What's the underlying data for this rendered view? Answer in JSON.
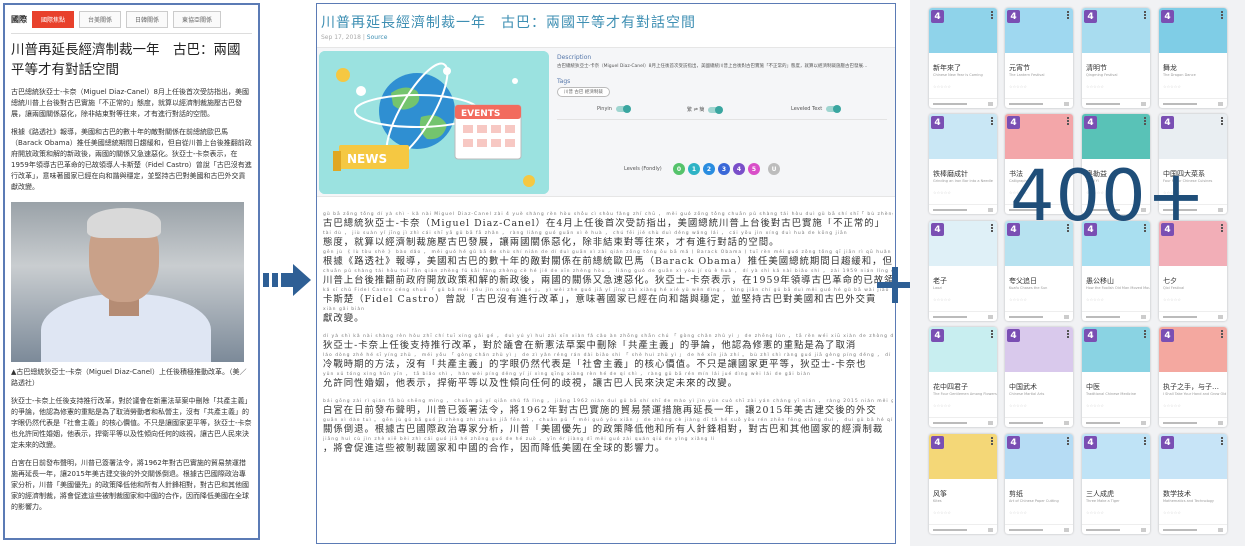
{
  "article": {
    "nav_home": "國際",
    "nav_tabs": [
      "國際焦點",
      "台美關係",
      "日韓關係",
      "東協亞關係"
    ],
    "title": "川普再延長經濟制裁一年　古巴：兩國平等才有對話空間",
    "para1": "古巴總統狄亞士-卡奈（Miguel Diaz-Canel）8月上任後首次受訪指出，美國總統川普上台後對古巴實施「不正常的」態度，就算以經濟制裁施壓古巴發展，讓兩國關係惡化，除非結束對等往來，才有進行對話的空間。",
    "para2": "根據《路透社》報導，美國和古巴的數十年的敵對關係在前總統歐巴馬（Barack Obama）推任美國總統期間日趨緩和，但自從川普上台後推翻前政府開放政策和解的新政後，兩國的關係又急速惡化。狄亞士-卡奈表示，在1959年領導古巴革命的已故領導人卡斯楚（Fidel Castro）曾說「古巴沒有進行改革」，意味著國家已經在向和諧與穩定，並堅持古巴對美國和古巴外交貢獻改變。",
    "caption": "▲古巴總統狄亞士-卡奈（Miguel Diaz-Canel）上任後積極推動改革。（美／路透社）",
    "para3": "狄亞士-卡奈上任後支持推行改革，對於議會在新憲法草案中刪除「共產主義」的爭論，他認為修憲的重點是為了取消勞動者和私營主，沒有「共產主義」的字眼仍然代表是「社會主義」的核心價值。不只是讓國家更平等，狄亞士-卡奈也允許同性婚姻，他表示，捍衛平等以及性傾向任何的歧視，讓古巴人民來決定未來的改變。",
    "para4": "白宮在日前發布聲明，川普已簽署法令，將1962年對古巴實施的貿易禁運措施再延長一年，讓2015年美古建交後的外交關係倒退。根據古巴國際政治專家分析，川普「美國優先」的政策降低他和所有人針鋒相對，對古巴和其他國家的經濟制裁，將會促進這些被制裁國家和中國的合作，因而降低美國在全球的影響力。"
  },
  "reader": {
    "title": "川普再延長經濟制裁一年　古巴：兩國平等才有對話空間",
    "date": "Sep 17, 2018 |",
    "source": "Source",
    "illus_events": "EVENTS",
    "illus_news": "NEWS",
    "description_label": "Description",
    "description_text": "古巴總統狄亞士-卡奈（Miguel Diaz-Canel）8月上任後首次受訪指出，美國總統川普上台後對古巴實施「不正常的」態度，就算以經濟制裁施壓古巴發展…",
    "tags_label": "Tags",
    "tag": "川普 古巴 經濟制裁",
    "toggles": [
      {
        "label": "Pinyin"
      },
      {
        "label": "繁 ⇌ 簡"
      },
      {
        "label": "Leveled Text"
      }
    ],
    "levels_label": "Levels (Fondly)",
    "levels": [
      {
        "label": "0",
        "color": "#55c36b"
      },
      {
        "label": "1",
        "color": "#2eb3c5"
      },
      {
        "label": "2",
        "color": "#2a8de0"
      },
      {
        "label": "3",
        "color": "#3a68d8"
      },
      {
        "label": "4",
        "color": "#7a4fc9"
      },
      {
        "label": "5",
        "color": "#d94fc8"
      },
      {
        "label": "U",
        "color": "#bdbdbd"
      }
    ],
    "lines": [
      {
        "py": "gǔ bā zǒng tǒng dí yà shì · kǎ nài     Miguel  Diaz-Canel    zài 4 yuè shàng rèn hòu shǒu cì shòu fǎng zhǐ chū ， měi guó zǒng tǒng chuān pǔ shàng tái hòu duì gǔ bā shí shī「 bù zhèng cháng de 」",
        "zh": "古巴總統狄亞士-卡奈（Miguel Diaz-Canel）在4月上任後首次受訪指出，美國總統川普上台後對古巴實施「不正常的」"
      },
      {
        "py": "tài dù ， jiù suàn yǐ jīng jì zhì cái shī yā gǔ bā fā zhǎn ， ràng liǎng guó guān xì è huà ， chú fēi jié shù duì děng wǎng lái ， cái yǒu jìn xíng duì huà de kōng jiān",
        "zh": "態度，就算以經濟制裁施壓古巴發展，讓兩國關係惡化，除非結束對等往來，才有進行對話的空間。"
      },
      {
        "py": "gēn jù 《 lù tòu shè 》 bào dǎo ， měi guó hé gǔ bā de shù shí nián de dí duì guān xì zài qián zǒng tǒng ōu bā mǎ  ( Barack Obama ) tuī rèn měi guó zǒng tǒng qī jiān rì qū huǎn hé",
        "zh": "根據《路透社》報導，美國和古巴的數十年的敵對關係在前總統歐巴馬（Barack Obama）推任美國總統期間日趨緩和，但自從"
      },
      {
        "py": "chuān pǔ shàng tái hòu tuī fān qián zhèng fǔ kāi fàng zhèng cè hé jiě de xīn zhèng hòu ， liǎng guó de guān xì yòu jí sù è huà ， dí yà shì kǎ nài biǎo shì ， zài 1959 nián lǐng dǎo gǔ bā gé mìng",
        "zh": "川普上台後推翻前政府開放政策和解的新政後，兩國的關係又急速惡化。狄亞士-卡奈表示，在1959年領導古巴革命的已故領導人"
      },
      {
        "py": "kǎ sī chǔ   Fidel Castro   céng shuō 「 gǔ bā méi yǒu jìn xíng gǎi gé 」， yì wèi zhe guó jiā yǐ jīng zài xiàng hé xié yǔ wěn dìng ， bìng jiān chí gǔ bā duì měi guó hé gǔ bā wài jiāo",
        "zh": "卡斯楚（Fidel Castro）曾說「古巴沒有進行改革」，意味著國家已經在向和諧與穩定，並堅持古巴對美國和古巴外交貢"
      },
      {
        "py": "xiàn gǎi biàn",
        "zh": "獻改變。"
      },
      {
        "py": "dí yà shì kǎ nài shàng rèn hòu zhī chí tuī xíng gǎi gé ， duì yú yì huì zài xīn xiàn fǎ cǎo àn zhōng shān chú 「 gòng chǎn zhǔ yì 」 de zhēng lùn ， tā rèn wéi xiū xiàn de zhòng diǎn shì wèi le qǔ xiāo",
        "zh": "狄亞士-卡奈上任後支持推行改革，對於議會在新憲法草案中刪除「共產主義」的爭論，他認為修憲的重點是為了取消"
      },
      {
        "py": "láo dòng zhě hé sī yíng zhǔ ， méi yǒu 「 gòng chǎn zhǔ yì 」 de zì yǎn réng rán dài biǎo shì 「 shè huì zhǔ yì 」 de hé xīn jià zhí 。 bù zhǐ shì ràng guó jiā gèng píng děng ， dí yà shì kǎ nài yě",
        "zh": "冷戰時期的方法，沒有「共產主義」的字眼仍然代表是「社會主義」的核心價值。不只是讓國家更平等，狄亞士-卡奈也"
      },
      {
        "py": "yǔn xǔ tóng xìng hūn yīn ， tā biǎo shì ， hàn wèi píng děng yǐ jí xìng qīng xiàng rèn hé de qí shì ， ràng gǔ bā rén mín lái jué dìng wèi lái de gǎi biàn",
        "zh": "允許同性婚姻，他表示，捍衛平等以及性傾向任何的歧視，讓古巴人民來決定未來的改變。"
      },
      {
        "py": "bái gōng zài rì qián fā bù shēng míng ， chuān pǔ yǐ qiān shǔ fǎ lìng ， jiāng 1962 nián duì gǔ bā shí shī de mào yì jìn yùn cuò shī zài yán cháng yī nián ， ràng 2015 nián měi gǔ jiàn jiāo hòu de wài jiāo",
        "zh": "白宮在日前發布聲明，川普已簽署法令，將1962年對古巴實施的貿易禁運措施再延長一年，讓2015年美古建交後的外交"
      },
      {
        "py": "guān xì dào tuì 。 gēn jù gǔ bā guó jì zhèng zhì zhuān jiā fēn xī ， chuān pǔ 「 měi guó yōu xiān 」 de zhèng cè jiàng dī tā hé suǒ yǒu rén zhēn fēng xiāng duì ， duì gǔ bā hé qí tā guó jiā de jīng jì zhì cái",
        "zh": "關係倒退。根據古巴國際政治專家分析，川普「美國優先」的政策降低他和所有人針鋒相對，對古巴和其他國家的經濟制裁"
      },
      {
        "py": "jiāng huì cù jìn zhè xiē bèi zhì cái guó jiā hé zhōng guó de hé zuò ， yīn ér jiàng dī měi guó zài quán qiú de yǐng xiǎng lì",
        "zh": "，將會促進這些被制裁國家和中國的合作，因而降低美國在全球的影響力。"
      }
    ]
  },
  "catalog": {
    "count_label": "400+",
    "level_badge": "4",
    "cards": [
      {
        "title": "新年來了",
        "sub": "Chinese New Year is Coming",
        "color": "#8fd3ea"
      },
      {
        "title": "元宵节",
        "sub": "The Lantern Festival",
        "color": "#9fd8f0"
      },
      {
        "title": "清明节",
        "sub": "Qingming Festival",
        "color": "#a8dcef"
      },
      {
        "title": "舞龙",
        "sub": "The Dragon Dance",
        "color": "#7fcde6"
      },
      {
        "title": "铁棒磨成针",
        "sub": "Grinding an Iron Bar into a Needle",
        "color": "#c9e7f5"
      },
      {
        "title": "书法",
        "sub": "Calligraphy",
        "color": "#f3a6a9"
      },
      {
        "title": "奥勒益",
        "sub": "Aolei Yi",
        "color": "#59c2b7"
      },
      {
        "title": "中国四大菜系",
        "sub": "Four Major Chinese Cuisines",
        "color": "#e9eef2"
      },
      {
        "title": "老子",
        "sub": "Laozi",
        "color": "#dff0f7"
      },
      {
        "title": "夸父追日",
        "sub": "Kuafu Chases the Sun",
        "color": "#b7e2f0"
      },
      {
        "title": "愚公移山",
        "sub": "How the Foolish Old Man Moved Mountains",
        "color": "#a9dff0"
      },
      {
        "title": "七夕",
        "sub": "Qixi Festival",
        "color": "#f2aeb7"
      },
      {
        "title": "花中四君子",
        "sub": "The Four Gentlemen Among Flowers",
        "color": "#c8eef0"
      },
      {
        "title": "中国武术",
        "sub": "Chinese Martial Arts",
        "color": "#d9c9ec"
      },
      {
        "title": "中医",
        "sub": "Traditional Chinese Medicine",
        "color": "#8ad3e3"
      },
      {
        "title": "执子之手，与子…",
        "sub": "I Shall Take Your Hand and Grow Old with You",
        "color": "#f4a8a0"
      },
      {
        "title": "风筝",
        "sub": "Kites",
        "color": "#f4d777"
      },
      {
        "title": "剪纸",
        "sub": "Art of Chinese Paper Cutting",
        "color": "#b6dcf4"
      },
      {
        "title": "三人成虎",
        "sub": "Three Make a Tiger",
        "color": "#bfe3f6"
      },
      {
        "title": "数学技术",
        "sub": "Mathematics and Technology",
        "color": "#c7e4f7"
      }
    ]
  },
  "colors": {
    "accent_blue": "#3e8fb3",
    "nav_active": "#e8412c",
    "level_purple": "#7a4fb3",
    "big_text": "#1f4e79"
  }
}
